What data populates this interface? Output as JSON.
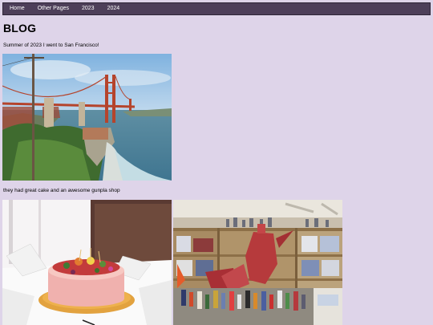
{
  "nav": {
    "items": [
      {
        "label": "Home"
      },
      {
        "label": "Other Pages"
      },
      {
        "label": "2023"
      },
      {
        "label": "2024"
      }
    ]
  },
  "page": {
    "title": "BLOG"
  },
  "posts": [
    {
      "text": "Summer of 2023 I went to San Francisco!"
    },
    {
      "text": "they had great cake and an awesome gunpla shop"
    }
  ],
  "colors": {
    "background": "#ded4e9",
    "nav_background": "#4d3f59",
    "nav_text": "#ffffff"
  }
}
